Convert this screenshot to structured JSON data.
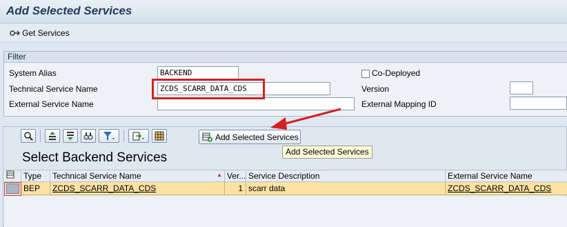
{
  "window": {
    "title": "Add Selected Services"
  },
  "app_toolbar": {
    "get_services_label": "Get Services"
  },
  "filter": {
    "header": "Filter",
    "system_alias": {
      "label": "System Alias",
      "value": "BACKEND"
    },
    "technical_service_name": {
      "label": "Technical Service Name",
      "value": "ZCDS_SCARR_DATA_CDS"
    },
    "external_service_name": {
      "label": "External Service Name",
      "value": ""
    },
    "co_deployed": {
      "label": "Co-Deployed",
      "checked": false
    },
    "version": {
      "label": "Version",
      "value": ""
    },
    "external_mapping_id": {
      "label": "External Mapping ID",
      "value": ""
    }
  },
  "alv": {
    "title": "Select Backend Services",
    "add_button_label": "Add Selected Services",
    "tooltip": "Add Selected Services",
    "columns": [
      "Type",
      "Technical Service Name",
      "Ver...",
      "Service Description",
      "External Service Name"
    ],
    "rows": [
      {
        "type": "BEP",
        "technical_service_name": "ZCDS_SCARR_DATA_CDS",
        "version": "1",
        "description": "scarr data",
        "external_service_name": "ZCDS_SCARR_DATA_CDS"
      }
    ]
  },
  "colors": {
    "highlight_box": "#d42020",
    "selected_row": "#fde2a3",
    "title": "#1f3b5c"
  }
}
